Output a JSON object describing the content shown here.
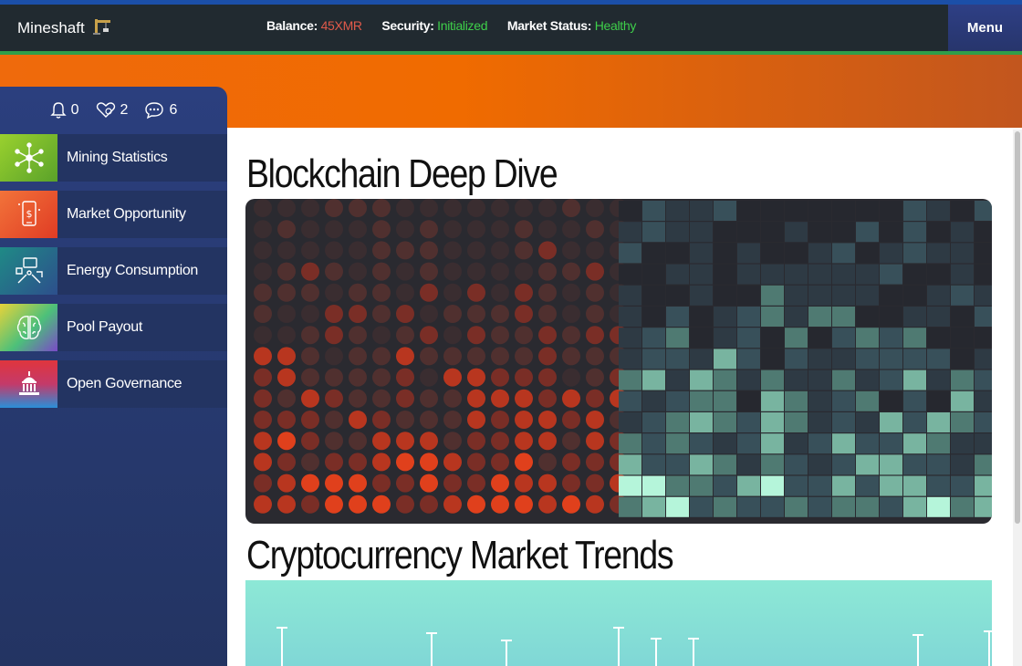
{
  "app": {
    "name": "Mineshaft"
  },
  "status": {
    "balance_label": "Balance:",
    "balance_value": "45XMR",
    "security_label": "Security:",
    "security_value": "Initialized",
    "market_label": "Market Status:",
    "market_value": "Healthy",
    "colors": {
      "balance": "#e05a4a",
      "ok": "#3ecf4a"
    }
  },
  "menu": {
    "label": "Menu"
  },
  "counts": {
    "notifications": "0",
    "favorites": "2",
    "messages": "6"
  },
  "sidebar": {
    "items": [
      {
        "label": "Mining Statistics",
        "icon": "network-icon",
        "color": "#7cc42c"
      },
      {
        "label": "Market Opportunity",
        "icon": "mobile-dollar-icon",
        "color": "#ef5a2a"
      },
      {
        "label": "Energy Consumption",
        "icon": "tools-icon",
        "color": "#2a6f8a"
      },
      {
        "label": "Pool Payout",
        "icon": "brain-icon",
        "color": "#e8d33a"
      },
      {
        "label": "Open Governance",
        "icon": "capitol-icon",
        "color": "#d9363e"
      }
    ]
  },
  "sections": [
    {
      "title": "Blockchain Deep Dive"
    },
    {
      "title": "Cryptocurrency Market Trends"
    }
  ]
}
